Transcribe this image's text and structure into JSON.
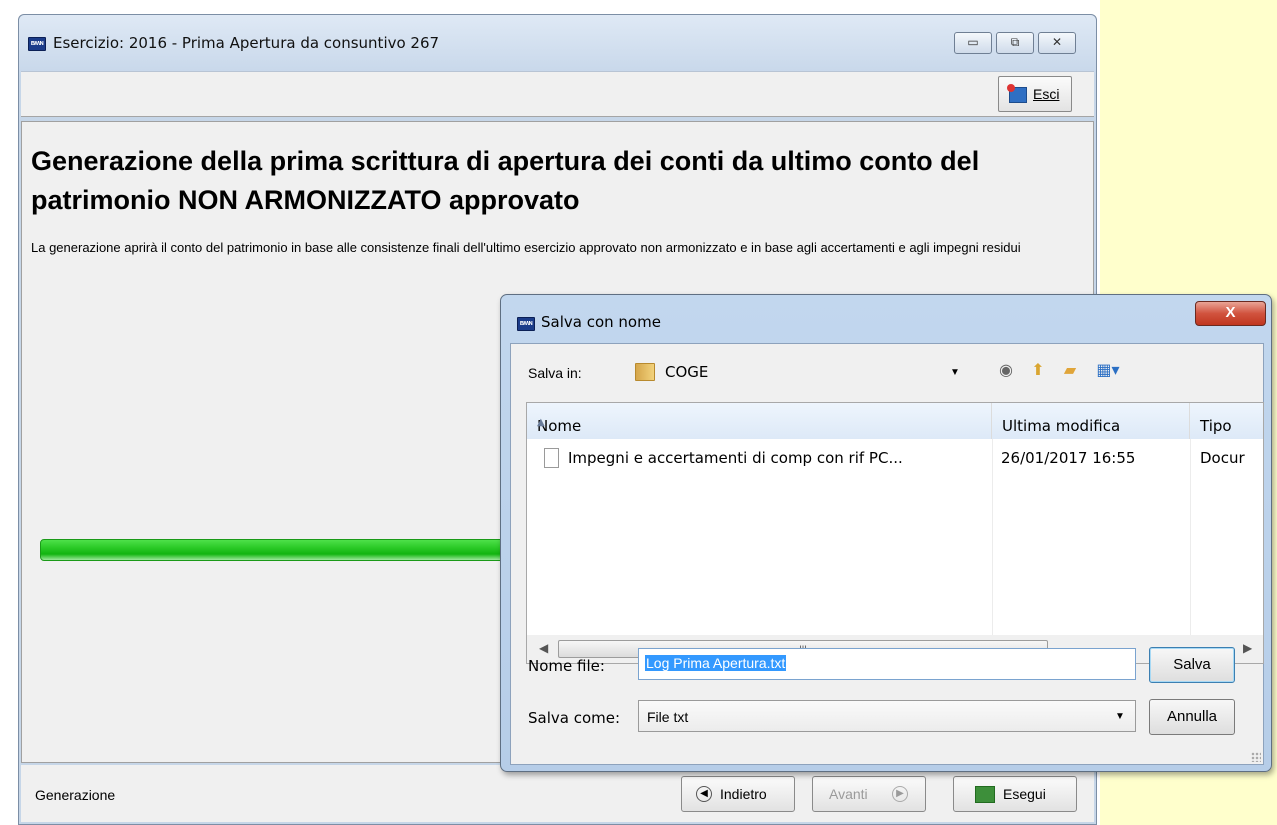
{
  "main_window": {
    "app_icon_text": "ʙʍɴ",
    "title": "Esercizio: 2016 - Prima Apertura da consuntivo 267",
    "toolbar": {
      "esci_label": "Esci"
    },
    "heading": "Generazione della prima scrittura di apertura dei conti da  ultimo conto del patrimonio NON ARMONIZZATO approvato",
    "description": "La generazione aprirà il conto del patrimonio in base alle consistenze finali dell'ultimo esercizio approvato non armonizzato e in base agli accertamenti e agli impegni residui",
    "status_text": "Generazione",
    "nav": {
      "indietro_label": "Indietro",
      "avanti_label": "Avanti",
      "esegui_label": "Esegui"
    }
  },
  "dialog": {
    "title": "Salva con nome",
    "close_glyph": "X",
    "salva_in_label": "Salva in:",
    "current_folder": "COGE",
    "columns": [
      "Nome",
      "Ultima modifica",
      "Tipo"
    ],
    "files": [
      {
        "name": "Impegni e accertamenti di comp con rif PC...",
        "modified": "26/01/2017 16:55",
        "type": "Docur"
      }
    ],
    "scroll_thumb_glyph": "III",
    "nome_file_label": "Nome file:",
    "nome_file_value": "Log Prima Apertura.txt",
    "salva_come_label": "Salva come:",
    "salva_come_value": "File txt",
    "salva_button": "Salva",
    "annulla_button": "Annulla"
  }
}
